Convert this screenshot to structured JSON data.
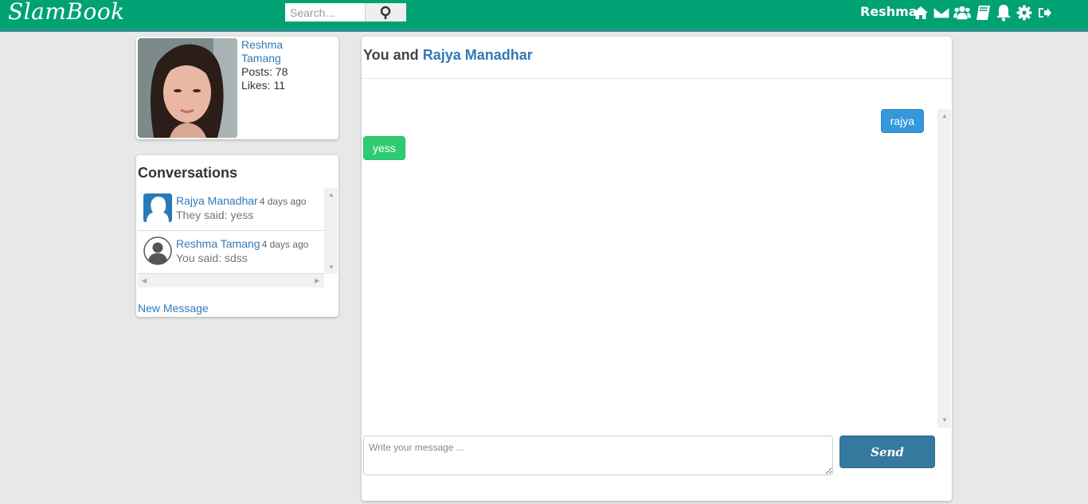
{
  "app": {
    "brand": "SlamBook"
  },
  "header": {
    "search_placeholder": "Search...",
    "user_name": "Reshma",
    "icons": [
      "home-icon",
      "envelope-icon",
      "users-icon",
      "book-icon",
      "bell-icon",
      "gear-icon",
      "logout-icon"
    ]
  },
  "profile": {
    "name": "Reshma Tamang",
    "posts": "Posts: 78",
    "likes": "Likes: 11"
  },
  "conversations": {
    "title": "Conversations",
    "items": [
      {
        "name": "Rajya Manadhar",
        "time": "4 days ago",
        "snippet": "They said: yess",
        "avatar": "female-silhouette"
      },
      {
        "name": "Reshma Tamang",
        "time": "4 days ago",
        "snippet": "You said: sdss",
        "avatar": "male-silhouette"
      }
    ],
    "new_message": "New Message"
  },
  "chat": {
    "title_prefix": "You and",
    "partner": "Rajya Manadhar",
    "messages": [
      {
        "text": "rajya",
        "from": "me"
      },
      {
        "text": "yess",
        "from": "them"
      }
    ],
    "input_placeholder": "Write your message ...",
    "send_label": "Send"
  },
  "colors": {
    "navbar": "#00a274",
    "link": "#337ab7",
    "bubble_mine": "#3498db",
    "bubble_theirs": "#2ecc71",
    "send_button": "#357a9e"
  }
}
